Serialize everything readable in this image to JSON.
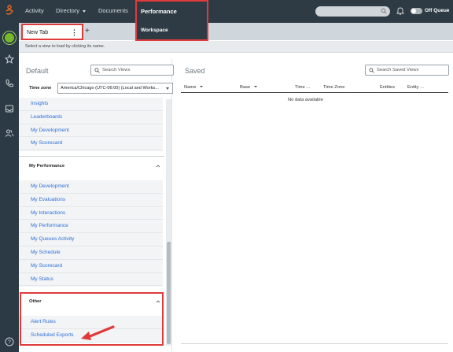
{
  "colors": {
    "rail_bg": "#2b3a44",
    "topnav_bg": "#2e3b44",
    "link": "#2f6fd6",
    "highlight": "#e03b3b",
    "avatar": "#76b82a",
    "logo": "#f26b21"
  },
  "rail": {
    "icons": [
      "genesys-logo-icon",
      "avatar-icon",
      "star-icon",
      "phone-icon",
      "inbox-icon",
      "people-icon",
      "help-icon"
    ]
  },
  "topnav": {
    "activity": "Activity",
    "directory": "Directory",
    "documents": "Documents",
    "performance": "Performance",
    "workspace": "Workspace",
    "queue_status": "Off Queue"
  },
  "tabs": {
    "active_tab": "New Tab",
    "add_label": "+"
  },
  "hint": "Select a view to load by clicking its name.",
  "default_panel": {
    "title": "Default",
    "search_placeholder": "Search Views",
    "timezone_label": "Time zone",
    "timezone_value": "America/Chicago (UTC-06:00) (Local and Works...",
    "top_items": [
      "Insights",
      "Leaderboards",
      "My Development",
      "My Scorecard"
    ],
    "sections": [
      {
        "title": "My Performance",
        "items": [
          "My Development",
          "My Evaluations",
          "My Interactions",
          "My Performance",
          "My Queues Activity",
          "My Schedule",
          "My Scorecard",
          "My Status"
        ]
      },
      {
        "title": "Other",
        "items": [
          "Alert Rules",
          "Scheduled Exports"
        ]
      }
    ]
  },
  "saved_panel": {
    "title": "Saved",
    "search_placeholder": "Search Saved Views",
    "columns": [
      "Name",
      "Base",
      "Time ...",
      "Time Zone",
      "Entities",
      "Entity ..."
    ],
    "empty_text": "No data available"
  }
}
